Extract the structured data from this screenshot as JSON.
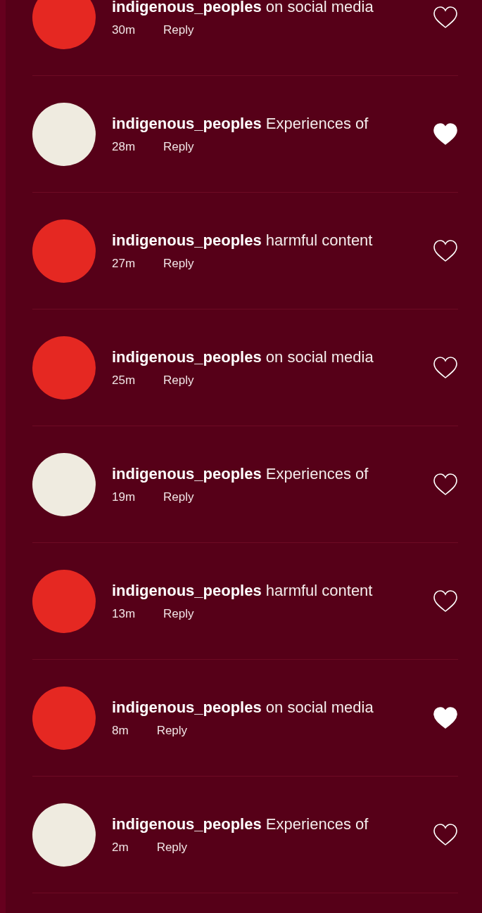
{
  "comments": [
    {
      "username": "indigenous_peoples",
      "text": "on social media",
      "time": "30m",
      "reply": "Reply",
      "liked": false,
      "color": "#e52822"
    },
    {
      "username": "indigenous_peoples",
      "text": "Experiences of",
      "time": "28m",
      "reply": "Reply",
      "liked": true,
      "color": "#efebe0"
    },
    {
      "username": "indigenous_peoples",
      "text": "harmful content",
      "time": "27m",
      "reply": "Reply",
      "liked": false,
      "color": "#e52822"
    },
    {
      "username": "indigenous_peoples",
      "text": "on social media",
      "time": "25m",
      "reply": "Reply",
      "liked": false,
      "color": "#e52822"
    },
    {
      "username": "indigenous_peoples",
      "text": "Experiences of",
      "time": "19m",
      "reply": "Reply",
      "liked": false,
      "color": "#efebe0"
    },
    {
      "username": "indigenous_peoples",
      "text": "harmful content",
      "time": "13m",
      "reply": "Reply",
      "liked": false,
      "color": "#e52822"
    },
    {
      "username": "indigenous_peoples",
      "text": "on social media",
      "time": "8m",
      "reply": "Reply",
      "liked": true,
      "color": "#e52822"
    },
    {
      "username": "indigenous_peoples",
      "text": "Experiences of",
      "time": "2m",
      "reply": "Reply",
      "liked": false,
      "color": "#efebe0"
    }
  ]
}
